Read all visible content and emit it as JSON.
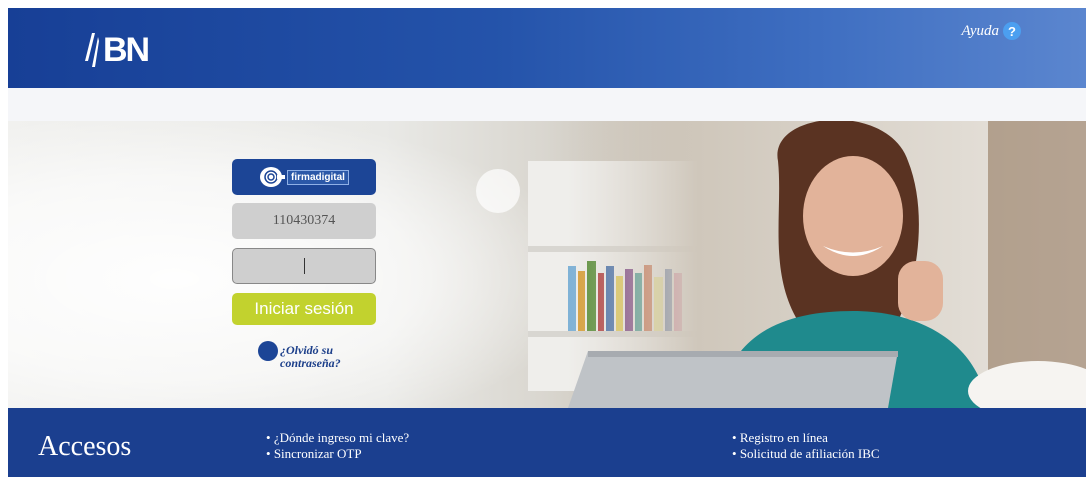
{
  "header": {
    "logo_text": "BN",
    "help_label": "Ayuda",
    "help_icon": "question-circle-icon"
  },
  "login": {
    "firma_label": "firmadigital",
    "username_value": "110430374",
    "password_value": "",
    "submit_label": "Iniciar sesión",
    "forgot_label": "¿Olvidó su contraseña?"
  },
  "footer": {
    "title": "Accesos",
    "links_left": [
      "¿Dónde ingreso mi clave?",
      "Sincronizar OTP"
    ],
    "links_right": [
      "Registro en línea",
      "Solicitud de afiliación IBC"
    ]
  },
  "colors": {
    "brand_blue": "#1b3f8f",
    "button_green": "#c2d22e",
    "field_gray": "#cfcfcf"
  }
}
